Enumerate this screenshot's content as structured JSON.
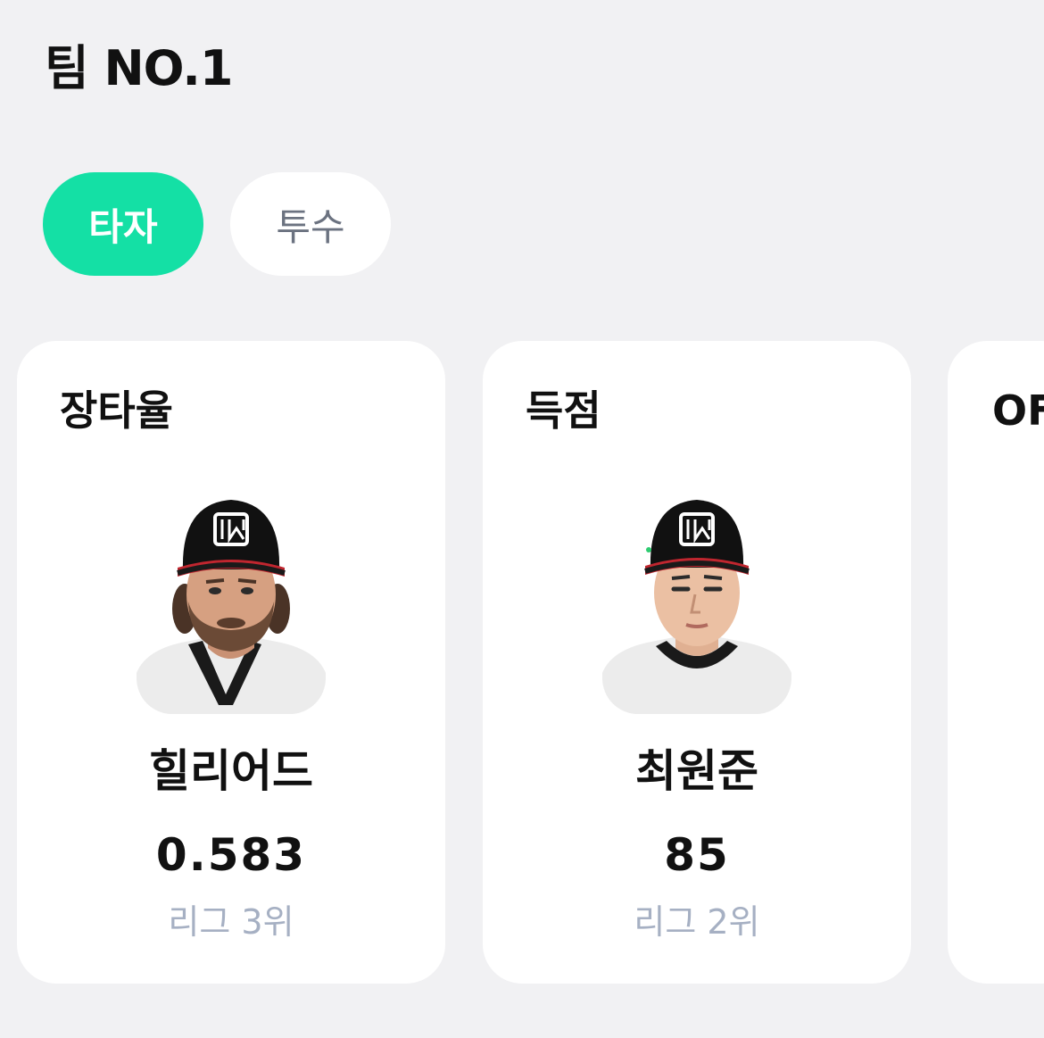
{
  "section": {
    "title": "팀 NO.1"
  },
  "tabs": [
    {
      "label": "타자",
      "active": true
    },
    {
      "label": "투수",
      "active": false
    }
  ],
  "cards": [
    {
      "category": "장타율",
      "player": "힐리어드",
      "value": "0.583",
      "rank": "리그 3위"
    },
    {
      "category": "득점",
      "player": "최원준",
      "value": "85",
      "rank": "리그 2위"
    },
    {
      "category": "OF"
    }
  ],
  "colors": {
    "accent": "#14e0a5",
    "background": "#f1f1f3",
    "card": "#ffffff",
    "rank_text": "#a6b0c3",
    "tab_inactive_text": "#6b7280"
  }
}
